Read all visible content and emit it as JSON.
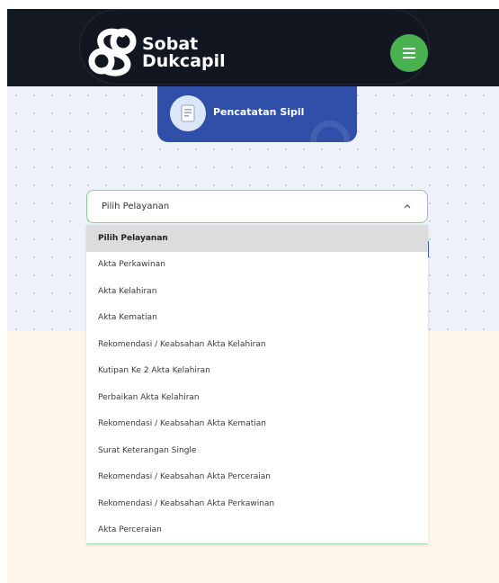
{
  "header": {
    "logo_line1": "Sobat",
    "logo_line2": "Dukcapil",
    "menu_icon": "hamburger-icon",
    "colors": {
      "bar": "#141821",
      "menu_button": "#49b14f"
    }
  },
  "service_card": {
    "label": "Pencatatan Sipil",
    "icon": "document-icon",
    "color": "#2f4fa8"
  },
  "select": {
    "value": "Pilih Pelayanan",
    "caret_icon": "chevron-up-icon"
  },
  "dropdown": {
    "options": [
      {
        "label": "Pilih Pelayanan",
        "selected": true
      },
      {
        "label": "Akta Perkawinan",
        "selected": false
      },
      {
        "label": "Akta Kelahiran",
        "selected": false
      },
      {
        "label": "Akta Kematian",
        "selected": false
      },
      {
        "label": "Rekomendasi / Keabsahan Akta Kelahiran",
        "selected": false
      },
      {
        "label": "Kutipan Ke 2 Akta Kelahiran",
        "selected": false
      },
      {
        "label": "Perbaikan Akta Kelahiran",
        "selected": false
      },
      {
        "label": "Rekomendasi / Keabsahan Akta Kematian",
        "selected": false
      },
      {
        "label": "Surat Keterangan Single",
        "selected": false
      },
      {
        "label": "Rekomendasi / Keabsahan Akta Perceraian",
        "selected": false
      },
      {
        "label": "Rekomendasi / Keabsahan Akta Perkawinan",
        "selected": false
      },
      {
        "label": "Akta Perceraian",
        "selected": false
      }
    ]
  }
}
